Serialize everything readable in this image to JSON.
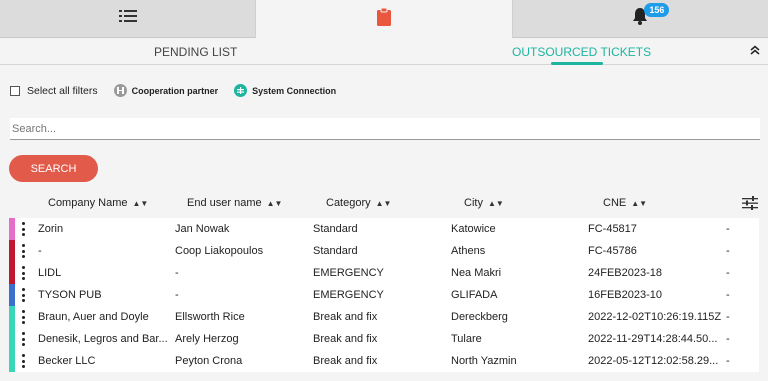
{
  "top_tabs": [
    {
      "icon": "list-icon"
    },
    {
      "icon": "clipboard-icon",
      "active": true
    },
    {
      "icon": "bell-icon",
      "badge": "156"
    }
  ],
  "sub_tabs": {
    "pending": "PENDING LIST",
    "outsourced": "OUTSOURCED TICKETS"
  },
  "filters": {
    "select_all": "Select all filters",
    "cooperation_partner": "Cooperation partner",
    "system_connection": "System Connection"
  },
  "search": {
    "placeholder": "Search...",
    "button_label": "SEARCH"
  },
  "table": {
    "columns": [
      "Company Name",
      "End user name",
      "Category",
      "City",
      "CNE"
    ],
    "rows": [
      {
        "color": "#e66ec8",
        "company": "Zorin",
        "end_user": "Jan Nowak",
        "category": "Standard",
        "city": "Katowice",
        "cne": "FC-45817",
        "extra": "-"
      },
      {
        "color": "#c0182f",
        "company": "-",
        "end_user": "Coop Liakopoulos",
        "category": "Standard",
        "city": "Athens",
        "cne": "FC-45786",
        "extra": "-"
      },
      {
        "color": "#c0182f",
        "company": "LIDL",
        "end_user": "-",
        "category": "EMERGENCY",
        "city": "Nea Makri",
        "cne": "24FEB2023-18",
        "extra": "-"
      },
      {
        "color": "#3a6fd0",
        "company": "TYSON PUB",
        "end_user": "-",
        "category": "EMERGENCY",
        "city": "GLIFADA",
        "cne": "16FEB2023-10",
        "extra": "-"
      },
      {
        "color": "#3ad6b8",
        "company": "Braun, Auer and Doyle",
        "end_user": "Ellsworth Rice",
        "category": "Break and fix",
        "city": "Dereckberg",
        "cne": "2022-12-02T10:26:19.115Z",
        "extra": "-"
      },
      {
        "color": "#3ad6b8",
        "company": "Denesik, Legros and Bar...",
        "end_user": "Arely Herzog",
        "category": "Break and fix",
        "city": "Tulare",
        "cne": "2022-11-29T14:28:44.50...",
        "extra": "-"
      },
      {
        "color": "#3ad6b8",
        "company": "Becker LLC",
        "end_user": "Peyton Crona",
        "category": "Break and fix",
        "city": "North Yazmin",
        "cne": "2022-05-12T12:02:58.29...",
        "extra": "-"
      }
    ]
  }
}
